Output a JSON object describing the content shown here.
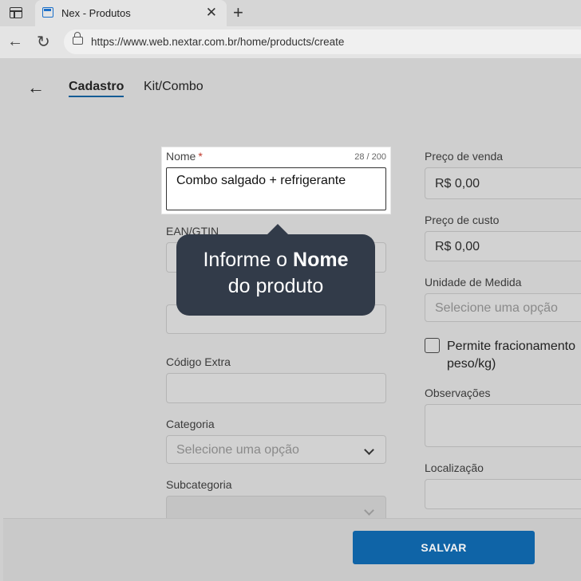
{
  "browser": {
    "tab_title": "Nex - Produtos",
    "url": "https://www.web.nextar.com.br/home/products/create"
  },
  "header": {
    "tabs": [
      "Cadastro",
      "Kit/Combo"
    ]
  },
  "form": {
    "nome": {
      "label": "Nome",
      "required_mark": "*",
      "counter": "28 / 200",
      "value": "Combo salgado + refrigerante"
    },
    "ean_label": "EAN/GTIN",
    "codigo_extra_label": "Código Extra",
    "categoria": {
      "label": "Categoria",
      "placeholder": "Selecione uma opção"
    },
    "subcategoria_label": "Subcategoria",
    "preco_venda": {
      "label": "Preço de venda",
      "value": "R$ 0,00"
    },
    "preco_custo": {
      "label": "Preço de custo",
      "value": "R$ 0,00"
    },
    "unidade": {
      "label": "Unidade de Medida",
      "placeholder": "Selecione uma opção"
    },
    "fracionamento": {
      "line1": "Permite fracionamento",
      "line2": "peso/kg)"
    },
    "observacoes_label": "Observações",
    "localizacao_label": "Localização"
  },
  "footer": {
    "save_label": "SALVAR"
  },
  "tooltip": {
    "prefix": "Informe o ",
    "bold": "Nome",
    "line2": "do produto"
  },
  "colors": {
    "accent": "#0f64a7",
    "tooltip_bg": "#323b49",
    "required": "#c0392b"
  }
}
